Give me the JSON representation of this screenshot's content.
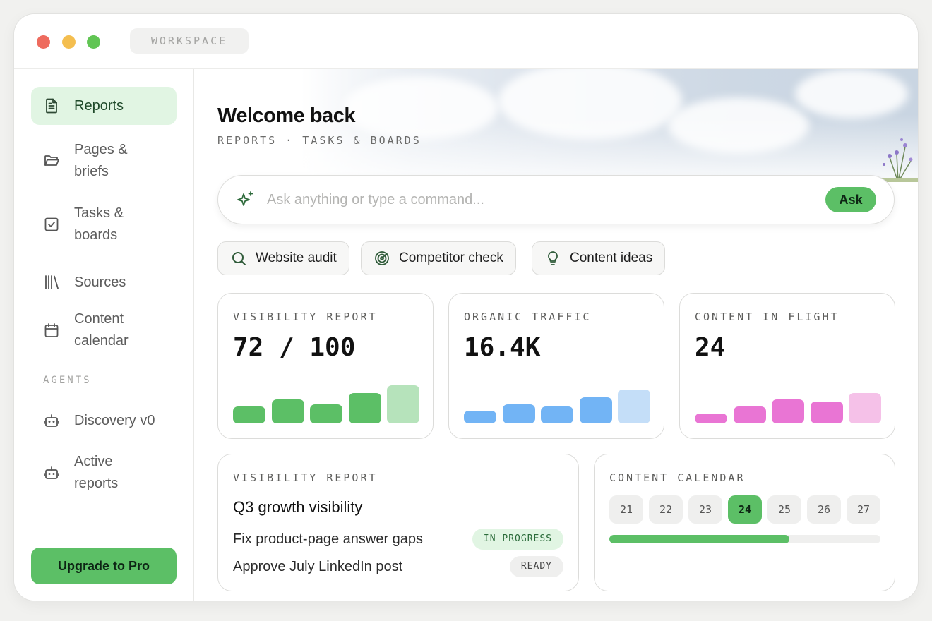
{
  "titlebar": {
    "workspace": "WORKSPACE"
  },
  "sidebar": {
    "items": [
      {
        "label": "Reports",
        "icon": "document-icon",
        "active": true
      },
      {
        "label": "Pages & briefs",
        "icon": "folder-icon"
      },
      {
        "label": "Tasks & boards",
        "icon": "checkbox-icon"
      },
      {
        "label": "Sources",
        "icon": "library-icon"
      },
      {
        "label": "Content calendar",
        "icon": "calendar-icon"
      }
    ],
    "agents_title": "AGENTS",
    "agents": [
      {
        "label": "Discovery v0",
        "icon": "robot-icon"
      },
      {
        "label": "Active reports",
        "icon": "robot-icon"
      }
    ],
    "upgrade_label": "Upgrade to Pro"
  },
  "header": {
    "welcome": "Welcome back",
    "breadcrumb": "REPORTS · TASKS & BOARDS"
  },
  "search": {
    "placeholder": "Ask anything or type a command...",
    "ask_label": "Ask"
  },
  "chips": [
    {
      "label": "Website audit",
      "icon": "search-icon"
    },
    {
      "label": "Competitor check",
      "icon": "radar-icon"
    },
    {
      "label": "Content ideas",
      "icon": "lightbulb-icon"
    }
  ],
  "metrics": [
    {
      "title": "VISIBILITY REPORT",
      "value": "72 / 100",
      "color": "#5cbf66",
      "light": "#b6e3bb"
    },
    {
      "title": "ORGANIC TRAFFIC",
      "value": "16.4K",
      "color": "#72b4f5",
      "light": "#c4def8"
    },
    {
      "title": "CONTENT IN FLIGHT",
      "value": "24",
      "color": "#e975d4",
      "light": "#f5c1e8"
    }
  ],
  "visibility_card": {
    "title": "VISIBILITY REPORT",
    "heading": "Q3 growth visibility",
    "tasks": [
      {
        "label": "Fix product-page answer gaps",
        "status": "IN PROGRESS"
      },
      {
        "label": "Approve July LinkedIn post",
        "status": "READY"
      }
    ]
  },
  "calendar_card": {
    "title": "CONTENT CALENDAR",
    "days": [
      "21",
      "22",
      "23",
      "24",
      "25",
      "26",
      "27"
    ],
    "selected_day": "24",
    "progress": 0.665
  },
  "colors": {
    "accent": "#5cbf66",
    "accent_soft": "#e1f5e3"
  }
}
